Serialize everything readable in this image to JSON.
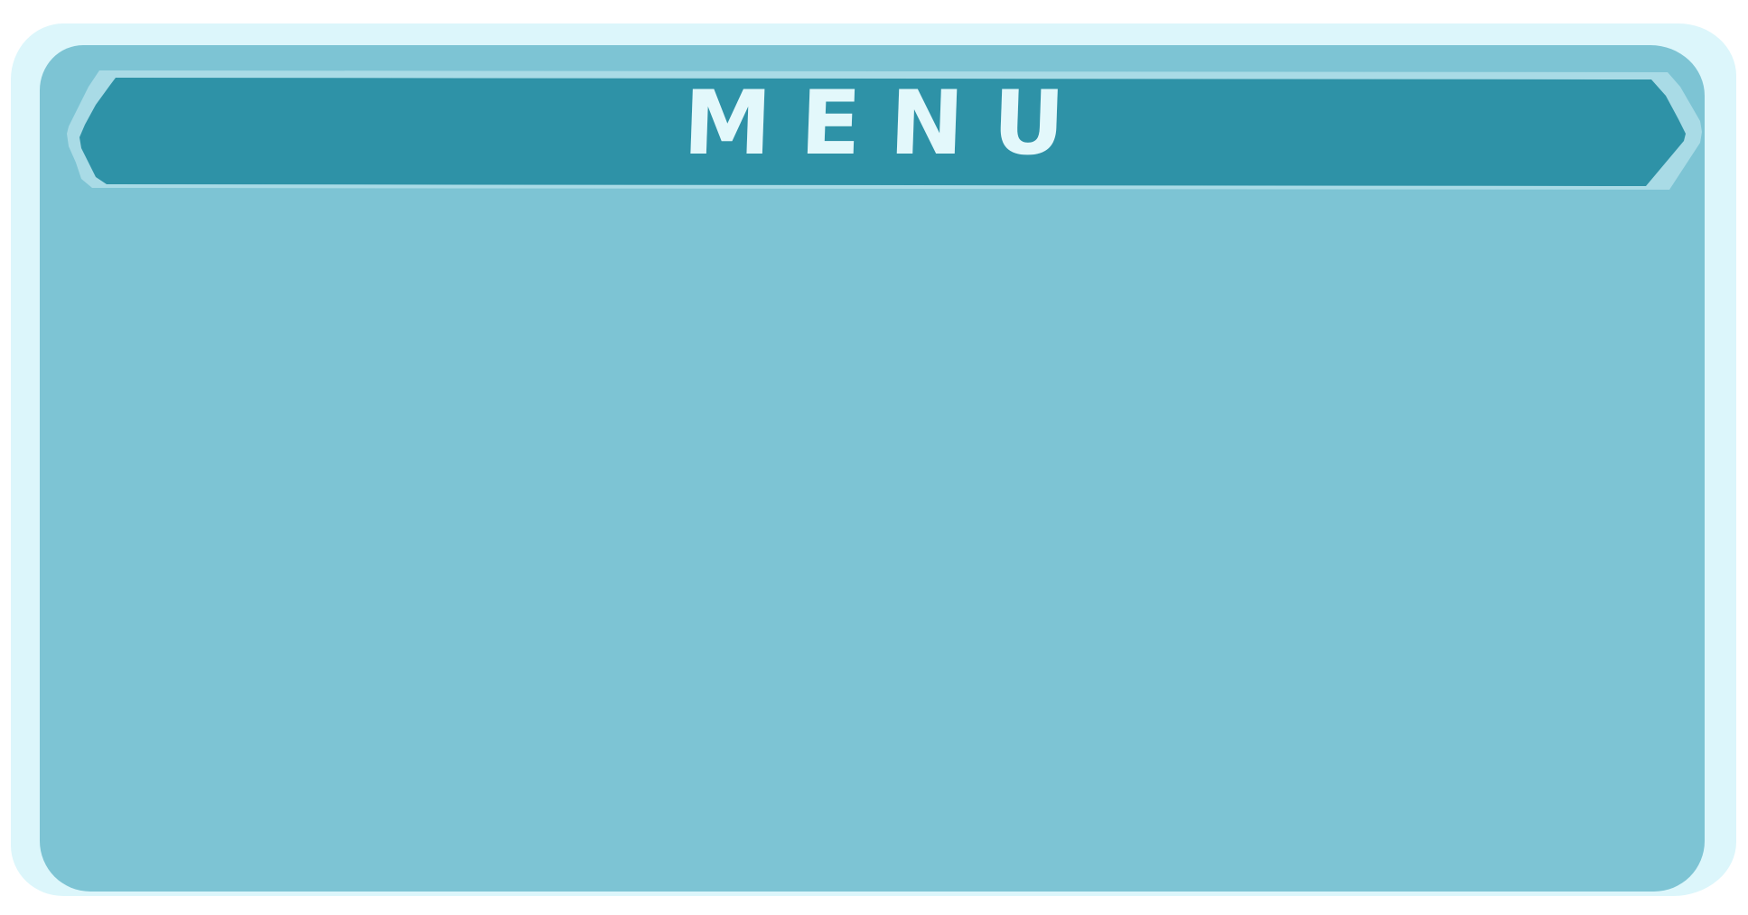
{
  "menu_panel": {
    "title": "MENU"
  },
  "colors": {
    "frame_outer": "#dcf6fb",
    "frame_inner": "#7dc4d4",
    "banner_rim": "#a9dbe6",
    "banner_fill": "#2e92a7",
    "title_text": "#e3f8fb"
  }
}
